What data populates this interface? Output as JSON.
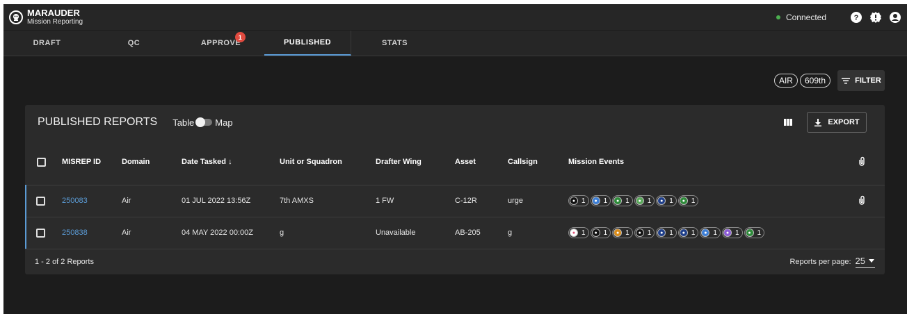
{
  "app": {
    "title": "MARAUDER",
    "subtitle": "Mission Reporting"
  },
  "status": {
    "label": "Connected",
    "color": "#4caf50"
  },
  "top_icons": [
    "help-icon",
    "alert-icon",
    "account-icon"
  ],
  "tabs": [
    {
      "label": "DRAFT"
    },
    {
      "label": "QC"
    },
    {
      "label": "APPROVE",
      "badge": "1"
    },
    {
      "label": "PUBLISHED",
      "active": true
    },
    {
      "label": "STATS"
    }
  ],
  "filters": {
    "chips": [
      "AIR",
      "609th"
    ],
    "button_label": "FILTER"
  },
  "card": {
    "title": "PUBLISHED REPORTS",
    "toggle_left": "Table",
    "toggle_right": "Map",
    "export_label": "EXPORT"
  },
  "table": {
    "headers": [
      "MISREP ID",
      "Domain",
      "Date Tasked",
      "Unit or Squadron",
      "Drafter Wing",
      "Asset",
      "Callsign",
      "Mission Events"
    ],
    "sort_indicator": "↓",
    "rows": [
      {
        "id": "250083",
        "domain": "Air",
        "date": "01 JUL 2022 13:56Z",
        "unit": "7th AMXS",
        "wing": "1 FW",
        "asset": "C-12R",
        "callsign": "urge",
        "attachment": true,
        "events": [
          {
            "icon": "skull-icon",
            "color": "#111111",
            "count": "1"
          },
          {
            "icon": "shield-icon",
            "color": "#3d7fd6",
            "count": "1"
          },
          {
            "icon": "headset-icon",
            "color": "#2e8b3a",
            "count": "1"
          },
          {
            "icon": "speaker-icon",
            "color": "#5aa85a",
            "count": "1"
          },
          {
            "icon": "slash-icon",
            "color": "#1f3f8a",
            "count": "1"
          },
          {
            "icon": "person-icon",
            "color": "#2e8b3a",
            "count": "1"
          }
        ]
      },
      {
        "id": "250838",
        "domain": "Air",
        "date": "04 MAY 2022 00:00Z",
        "unit": "g",
        "wing": "Unavailable",
        "asset": "AB-205",
        "callsign": "g",
        "attachment": false,
        "events": [
          {
            "icon": "heart-icon",
            "color": "#ffffff",
            "count": "1"
          },
          {
            "icon": "target-icon",
            "color": "#111111",
            "count": "1"
          },
          {
            "icon": "lightning-icon",
            "color": "#d98c1a",
            "count": "1"
          },
          {
            "icon": "warning-icon",
            "color": "#111111",
            "count": "1"
          },
          {
            "icon": "crosshair-icon",
            "color": "#1f3f8a",
            "count": "1"
          },
          {
            "icon": "slash-icon",
            "color": "#1f3f8a",
            "count": "1"
          },
          {
            "icon": "parachute-icon",
            "color": "#3d7fd6",
            "count": "1"
          },
          {
            "icon": "plane-icon",
            "color": "#8c5bd6",
            "count": "1"
          },
          {
            "icon": "headset-icon",
            "color": "#2e8b3a",
            "count": "1"
          }
        ]
      }
    ]
  },
  "footer": {
    "range": "1 - 2 of 2 Reports",
    "per_page_label": "Reports per page:",
    "per_page_value": "25"
  },
  "accent_color": "#5b9bd5"
}
